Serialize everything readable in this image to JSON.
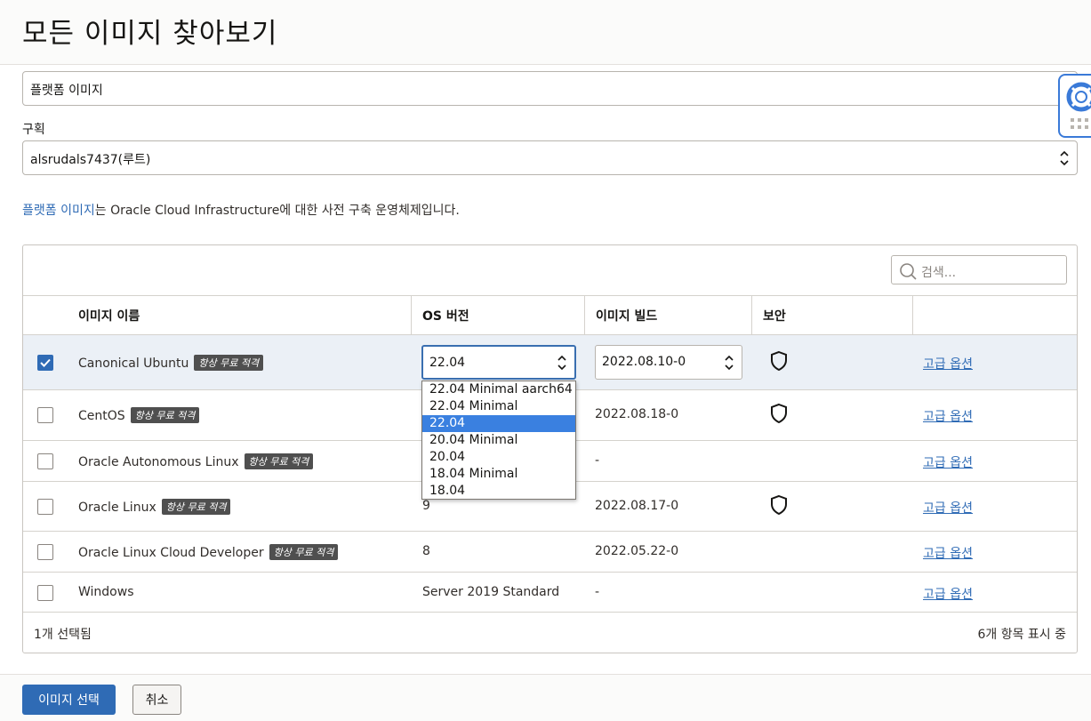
{
  "page_title": "모든 이미지 찾아보기",
  "image_source": {
    "value": "플랫폼 이미지"
  },
  "compartment": {
    "label": "구획",
    "value": "alsrudals7437(루트)"
  },
  "info": {
    "link_text": "플랫폼 이미지",
    "text": "는 Oracle Cloud Infrastructure에 대한 사전 구축 운영체제입니다."
  },
  "search": {
    "placeholder": "검색..."
  },
  "table": {
    "headers": {
      "name": "이미지 이름",
      "os_version": "OS 버전",
      "build": "이미지 빌드",
      "security": "보안"
    },
    "badge": "항상 무료 적격",
    "advanced_label": "고급 옵션",
    "rows": [
      {
        "name": "Canonical Ubuntu",
        "os_version": "22.04",
        "build": "2022.08.10-0",
        "selected": true,
        "shield": true
      },
      {
        "name": "CentOS",
        "os_version": "",
        "build": "2022.08.18-0",
        "selected": false,
        "shield": true
      },
      {
        "name": "Oracle Autonomous Linux",
        "os_version": "",
        "build": "-",
        "selected": false,
        "shield": false
      },
      {
        "name": "Oracle Linux",
        "os_version": "9",
        "build": "2022.08.17-0",
        "selected": false,
        "shield": true
      },
      {
        "name": "Oracle Linux Cloud Developer",
        "os_version": "8",
        "build": "2022.05.22-0",
        "selected": false,
        "shield": false
      },
      {
        "name": "Windows",
        "os_version": "Server 2019 Standard",
        "build": "-",
        "selected": false,
        "shield": false
      }
    ],
    "dropdown_options": [
      "22.04 Minimal aarch64",
      "22.04 Minimal",
      "22.04",
      "20.04 Minimal",
      "20.04",
      "18.04 Minimal",
      "18.04"
    ],
    "dropdown_selected": "22.04",
    "footer_selected": "1개 선택됨",
    "footer_count": "6개 항목 표시 중"
  },
  "buttons": {
    "select": "이미지 선택",
    "cancel": "취소"
  },
  "colors": {
    "accent": "#2f6bb5",
    "selected_row": "#ebf0f6",
    "dropdown_highlight": "#3a80e0"
  }
}
